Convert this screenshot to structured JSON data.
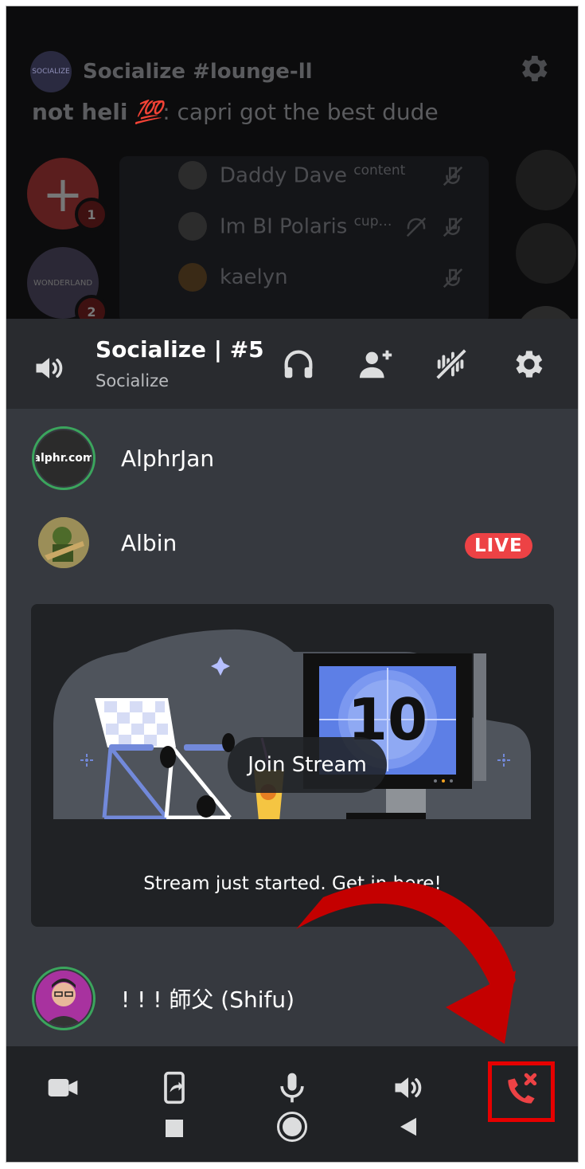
{
  "background": {
    "server_name": "Socialize #lounge-ll",
    "server_icon_text": "SOCIALIZE",
    "message_author": "not heli",
    "message_emoji": "💯",
    "message_text": ": capri got the best dude",
    "ping_counts": [
      "1",
      "2"
    ],
    "server_badge_text": "WONDERLAND",
    "voice_users": [
      {
        "name": "Daddy Dave",
        "tag": "content"
      },
      {
        "name": "Im BI Polaris",
        "tag": "cup…"
      },
      {
        "name": "kaelyn",
        "tag": ""
      }
    ]
  },
  "voice_header": {
    "title": "Socialize | #5",
    "subtitle": "Socialize"
  },
  "participants": [
    {
      "name": "AlphrJan",
      "avatar_text": "alphr.com"
    },
    {
      "name": "Albin",
      "badge": "LIVE"
    },
    {
      "name": "! ! ! 師父 (Shifu)"
    }
  ],
  "stream_card": {
    "join_label": "Join Stream",
    "caption": "Stream just started. Get in here!",
    "countdown": "10"
  },
  "colors": {
    "accent_red": "#ed4245",
    "speaking_green": "#3ba55d",
    "highlight_box": "#e60000"
  }
}
